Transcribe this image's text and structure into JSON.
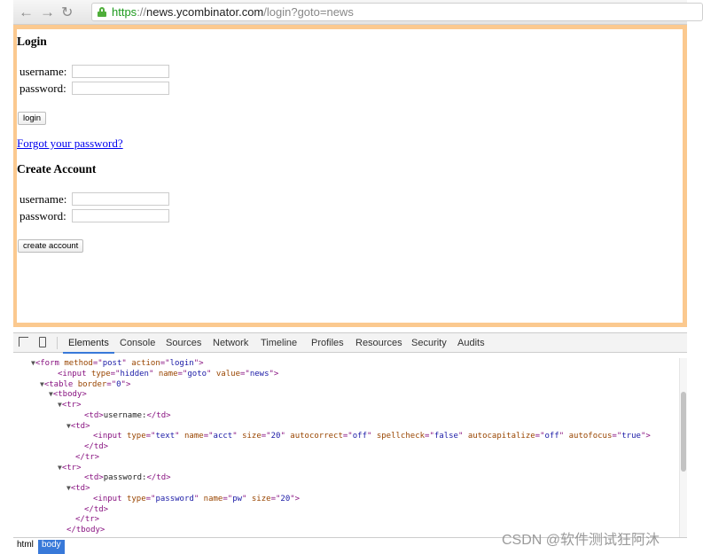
{
  "browser": {
    "url_scheme": "https",
    "url_sep": "://",
    "url_host": "news.ycombinator.com",
    "url_path": "/login?goto=news",
    "back": "←",
    "forward": "→",
    "reload": "↻"
  },
  "login": {
    "title": "Login",
    "username_label": "username:",
    "password_label": "password:",
    "username_value": "",
    "password_value": "",
    "button": "login",
    "forgot": "Forgot your password?"
  },
  "create": {
    "title": "Create Account",
    "username_label": "username:",
    "password_label": "password:",
    "username_value": "",
    "password_value": "",
    "button": "create account"
  },
  "devtools": {
    "tabs": [
      "Elements",
      "Console",
      "Sources",
      "Network",
      "Timeline",
      "Profiles",
      "Resources",
      "Security",
      "Audits"
    ],
    "active_tab": "Elements",
    "lines": [
      {
        "indent": 0,
        "tri": "▼",
        "tokens": [
          [
            "t",
            "<form "
          ],
          [
            "a",
            "method"
          ],
          [
            "t",
            "=\""
          ],
          [
            "v",
            "post"
          ],
          [
            "t",
            "\" "
          ],
          [
            "a",
            "action"
          ],
          [
            "t",
            "=\""
          ],
          [
            "v",
            "login"
          ],
          [
            "t",
            "\">"
          ]
        ]
      },
      {
        "indent": 2,
        "tri": "",
        "tokens": [
          [
            "t",
            "<input "
          ],
          [
            "a",
            "type"
          ],
          [
            "t",
            "=\""
          ],
          [
            "v",
            "hidden"
          ],
          [
            "t",
            "\" "
          ],
          [
            "a",
            "name"
          ],
          [
            "t",
            "=\""
          ],
          [
            "v",
            "goto"
          ],
          [
            "t",
            "\" "
          ],
          [
            "a",
            "value"
          ],
          [
            "t",
            "=\""
          ],
          [
            "v",
            "news"
          ],
          [
            "t",
            "\">"
          ]
        ]
      },
      {
        "indent": 1,
        "tri": "▼",
        "tokens": [
          [
            "t",
            "<table "
          ],
          [
            "a",
            "border"
          ],
          [
            "t",
            "=\""
          ],
          [
            "v",
            "0"
          ],
          [
            "t",
            "\">"
          ]
        ]
      },
      {
        "indent": 2,
        "tri": "▼",
        "tokens": [
          [
            "t",
            "<tbody>"
          ]
        ]
      },
      {
        "indent": 3,
        "tri": "▼",
        "tokens": [
          [
            "t",
            "<tr>"
          ]
        ]
      },
      {
        "indent": 5,
        "tri": "",
        "tokens": [
          [
            "t",
            "<td>"
          ],
          [
            "x",
            "username:"
          ],
          [
            "t",
            "</td>"
          ]
        ]
      },
      {
        "indent": 4,
        "tri": "▼",
        "tokens": [
          [
            "t",
            "<td>"
          ]
        ]
      },
      {
        "indent": 6,
        "tri": "",
        "tokens": [
          [
            "t",
            "<input "
          ],
          [
            "a",
            "type"
          ],
          [
            "t",
            "=\""
          ],
          [
            "v",
            "text"
          ],
          [
            "t",
            "\" "
          ],
          [
            "a",
            "name"
          ],
          [
            "t",
            "=\""
          ],
          [
            "v",
            "acct"
          ],
          [
            "t",
            "\" "
          ],
          [
            "a",
            "size"
          ],
          [
            "t",
            "=\""
          ],
          [
            "v",
            "20"
          ],
          [
            "t",
            "\" "
          ],
          [
            "a",
            "autocorrect"
          ],
          [
            "t",
            "=\""
          ],
          [
            "v",
            "off"
          ],
          [
            "t",
            "\" "
          ],
          [
            "a",
            "spellcheck"
          ],
          [
            "t",
            "=\""
          ],
          [
            "v",
            "false"
          ],
          [
            "t",
            "\" "
          ],
          [
            "a",
            "autocapitalize"
          ],
          [
            "t",
            "=\""
          ],
          [
            "v",
            "off"
          ],
          [
            "t",
            "\" "
          ],
          [
            "a",
            "autofocus"
          ],
          [
            "t",
            "=\""
          ],
          [
            "v",
            "true"
          ],
          [
            "t",
            "\">"
          ]
        ]
      },
      {
        "indent": 5,
        "tri": "",
        "tokens": [
          [
            "t",
            "</td>"
          ]
        ]
      },
      {
        "indent": 4,
        "tri": "",
        "tokens": [
          [
            "t",
            "</tr>"
          ]
        ]
      },
      {
        "indent": 3,
        "tri": "▼",
        "tokens": [
          [
            "t",
            "<tr>"
          ]
        ]
      },
      {
        "indent": 5,
        "tri": "",
        "tokens": [
          [
            "t",
            "<td>"
          ],
          [
            "x",
            "password:"
          ],
          [
            "t",
            "</td>"
          ]
        ]
      },
      {
        "indent": 4,
        "tri": "▼",
        "tokens": [
          [
            "t",
            "<td>"
          ]
        ]
      },
      {
        "indent": 6,
        "tri": "",
        "tokens": [
          [
            "t",
            "<input "
          ],
          [
            "a",
            "type"
          ],
          [
            "t",
            "=\""
          ],
          [
            "v",
            "password"
          ],
          [
            "t",
            "\" "
          ],
          [
            "a",
            "name"
          ],
          [
            "t",
            "=\""
          ],
          [
            "v",
            "pw"
          ],
          [
            "t",
            "\" "
          ],
          [
            "a",
            "size"
          ],
          [
            "t",
            "=\""
          ],
          [
            "v",
            "20"
          ],
          [
            "t",
            "\">"
          ]
        ]
      },
      {
        "indent": 5,
        "tri": "",
        "tokens": [
          [
            "t",
            "</td>"
          ]
        ]
      },
      {
        "indent": 4,
        "tri": "",
        "tokens": [
          [
            "t",
            "</tr>"
          ]
        ]
      },
      {
        "indent": 3,
        "tri": "",
        "tokens": [
          [
            "t",
            "</tbody>"
          ]
        ]
      }
    ],
    "breadcrumbs": [
      "html",
      "body"
    ],
    "selected_crumb": "body"
  },
  "watermark": "CSDN @软件测试狂阿沐",
  "colors": {
    "page_border": "#fbc98f",
    "accent": "#3879d9",
    "link": "#0000ee"
  }
}
